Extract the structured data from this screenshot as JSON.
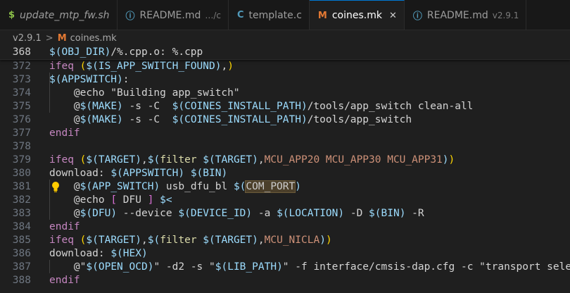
{
  "tabs": [
    {
      "icon": "$",
      "label": "update_mtp_fw.sh",
      "desc": "",
      "active": false,
      "italic": true
    },
    {
      "icon": "ⓘ",
      "label": "README.md",
      "desc": "…/c",
      "active": false,
      "italic": false
    },
    {
      "icon": "C",
      "label": "template.c",
      "desc": "",
      "active": false,
      "italic": false
    },
    {
      "icon": "M",
      "label": "coines.mk",
      "desc": "",
      "active": true,
      "italic": false,
      "close": "✕"
    },
    {
      "icon": "ⓘ",
      "label": "README.md",
      "desc": "v2.9.1",
      "active": false,
      "italic": false
    }
  ],
  "colors": {
    "active_tab_border": "#0078d4",
    "mk_icon": "#e37933",
    "sh_icon": "#8dc149",
    "c_icon": "#519aba",
    "md_icon": "#519aba",
    "bulb": "#ffcc00"
  },
  "breadcrumb": {
    "folder": "v2.9.1",
    "separator": ">",
    "file_icon": "M",
    "file": "coines.mk"
  },
  "sticky_line": {
    "num": "368",
    "tokens": [
      [
        "v",
        "$(OBJ_DIR)"
      ],
      [
        "op",
        "/%.cpp.o: %.cpp"
      ]
    ]
  },
  "lines": [
    {
      "num": "372",
      "tokens": [
        [
          "kw",
          "ifeq "
        ],
        [
          "p1",
          "("
        ],
        [
          "v",
          "$("
        ],
        [
          "v",
          "IS_APP_SWITCH_FOUND"
        ],
        [
          "v",
          ")"
        ],
        [
          "op",
          ","
        ],
        [
          "p1",
          ")"
        ]
      ]
    },
    {
      "num": "373",
      "tokens": [
        [
          "v",
          "$("
        ],
        [
          "v",
          "APPSWITCH"
        ],
        [
          "v",
          ")"
        ],
        [
          "op",
          ":"
        ]
      ]
    },
    {
      "num": "374",
      "tokens": [
        [
          "op",
          "    @echo \"Building app_switch\""
        ]
      ]
    },
    {
      "num": "375",
      "tokens": [
        [
          "op",
          "    @"
        ],
        [
          "v",
          "$("
        ],
        [
          "v",
          "MAKE"
        ],
        [
          "v",
          ")"
        ],
        [
          "op",
          " -s -C  "
        ],
        [
          "v",
          "$("
        ],
        [
          "v",
          "COINES_INSTALL_PATH"
        ],
        [
          "v",
          ")"
        ],
        [
          "op",
          "/tools/app_switch clean-all"
        ]
      ]
    },
    {
      "num": "376",
      "tokens": [
        [
          "op",
          "    @"
        ],
        [
          "v",
          "$("
        ],
        [
          "v",
          "MAKE"
        ],
        [
          "v",
          ")"
        ],
        [
          "op",
          " -s -C  "
        ],
        [
          "v",
          "$("
        ],
        [
          "v",
          "COINES_INSTALL_PATH"
        ],
        [
          "v",
          ")"
        ],
        [
          "op",
          "/tools/app_switch"
        ]
      ]
    },
    {
      "num": "377",
      "tokens": [
        [
          "kw",
          "endif"
        ]
      ]
    },
    {
      "num": "378",
      "tokens": []
    },
    {
      "num": "379",
      "tokens": [
        [
          "kw",
          "ifeq "
        ],
        [
          "p1",
          "("
        ],
        [
          "v",
          "$("
        ],
        [
          "v",
          "TARGET"
        ],
        [
          "v",
          ")"
        ],
        [
          "op",
          ","
        ],
        [
          "v",
          "$("
        ],
        [
          "fn",
          "filter "
        ],
        [
          "v",
          "$("
        ],
        [
          "v",
          "TARGET"
        ],
        [
          "v",
          ")"
        ],
        [
          "op",
          ","
        ],
        [
          "str",
          "MCU_APP20 MCU_APP30 MCU_APP31"
        ],
        [
          "v",
          ")"
        ],
        [
          "p1",
          ")"
        ]
      ]
    },
    {
      "num": "380",
      "tokens": [
        [
          "op",
          "download: "
        ],
        [
          "v",
          "$("
        ],
        [
          "v",
          "APPSWITCH"
        ],
        [
          "v",
          ")"
        ],
        [
          "op",
          " "
        ],
        [
          "v",
          "$("
        ],
        [
          "v",
          "BIN"
        ],
        [
          "v",
          ")"
        ]
      ]
    },
    {
      "num": "381",
      "bulb": true,
      "tokens": [
        [
          "op",
          "    @"
        ],
        [
          "v",
          "$("
        ],
        [
          "v",
          "APP_SWITCH"
        ],
        [
          "v",
          ")"
        ],
        [
          "op",
          " usb_dfu_bl "
        ],
        [
          "v",
          "$("
        ],
        [
          "hl",
          "COM_PORT"
        ],
        [
          "v",
          ")"
        ]
      ]
    },
    {
      "num": "382",
      "tokens": [
        [
          "op",
          "    @echo "
        ],
        [
          "p2",
          "["
        ],
        [
          "op",
          " DFU "
        ],
        [
          "p2",
          "]"
        ],
        [
          "op",
          " "
        ],
        [
          "v",
          "$<"
        ]
      ]
    },
    {
      "num": "383",
      "tokens": [
        [
          "op",
          "    @"
        ],
        [
          "v",
          "$("
        ],
        [
          "v",
          "DFU"
        ],
        [
          "v",
          ")"
        ],
        [
          "op",
          " --device "
        ],
        [
          "v",
          "$("
        ],
        [
          "v",
          "DEVICE_ID"
        ],
        [
          "v",
          ")"
        ],
        [
          "op",
          " -a "
        ],
        [
          "v",
          "$("
        ],
        [
          "v",
          "LOCATION"
        ],
        [
          "v",
          ")"
        ],
        [
          "op",
          " -D "
        ],
        [
          "v",
          "$("
        ],
        [
          "v",
          "BIN"
        ],
        [
          "v",
          ")"
        ],
        [
          "op",
          " -R"
        ]
      ]
    },
    {
      "num": "384",
      "tokens": [
        [
          "kw",
          "endif"
        ]
      ]
    },
    {
      "num": "385",
      "tokens": [
        [
          "kw",
          "ifeq "
        ],
        [
          "p1",
          "("
        ],
        [
          "v",
          "$("
        ],
        [
          "v",
          "TARGET"
        ],
        [
          "v",
          ")"
        ],
        [
          "op",
          ","
        ],
        [
          "v",
          "$("
        ],
        [
          "fn",
          "filter "
        ],
        [
          "v",
          "$("
        ],
        [
          "v",
          "TARGET"
        ],
        [
          "v",
          ")"
        ],
        [
          "op",
          ","
        ],
        [
          "str",
          "MCU_NICLA"
        ],
        [
          "v",
          ")"
        ],
        [
          "p1",
          ")"
        ]
      ]
    },
    {
      "num": "386",
      "tokens": [
        [
          "op",
          "download: "
        ],
        [
          "v",
          "$("
        ],
        [
          "v",
          "HEX"
        ],
        [
          "v",
          ")"
        ]
      ]
    },
    {
      "num": "387",
      "tokens": [
        [
          "op",
          "    @\""
        ],
        [
          "v",
          "$("
        ],
        [
          "v",
          "OPEN_OCD"
        ],
        [
          "v",
          ")"
        ],
        [
          "op",
          "\" -d2 -s \""
        ],
        [
          "v",
          "$("
        ],
        [
          "v",
          "LIB_PATH"
        ],
        [
          "v",
          ")"
        ],
        [
          "op",
          "\" -f interface/cmsis-dap.cfg -c \"transport select swd\""
        ]
      ]
    },
    {
      "num": "388",
      "tokens": [
        [
          "kw",
          "endif"
        ]
      ]
    }
  ]
}
